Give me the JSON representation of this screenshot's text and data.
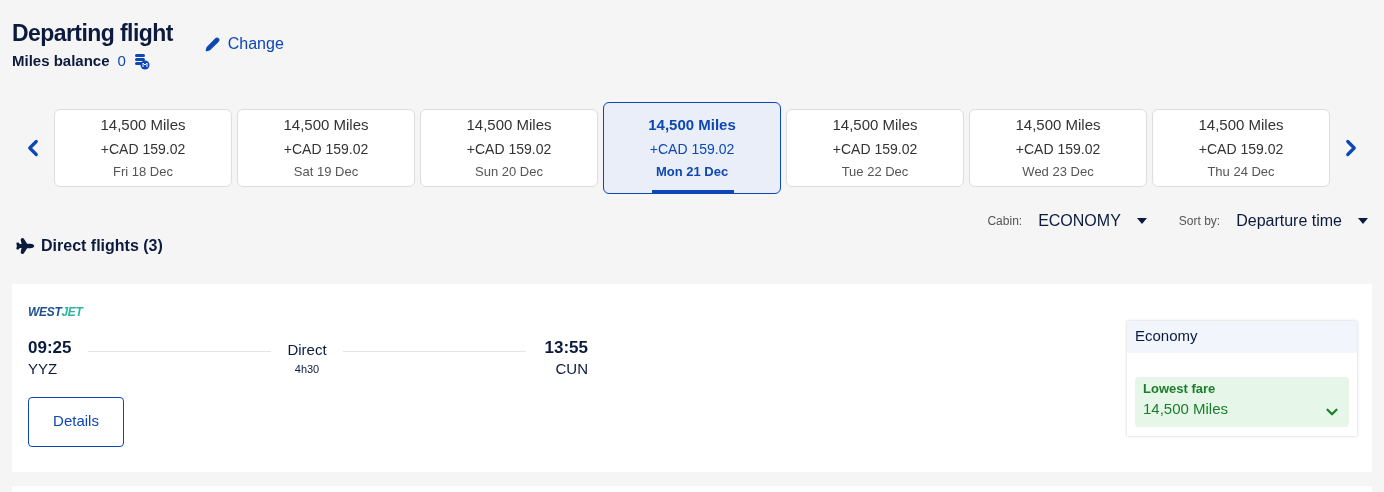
{
  "header": {
    "title": "Departing flight",
    "change_link": "Change",
    "balance_label": "Miles balance",
    "balance_value": "0"
  },
  "dates": [
    {
      "miles": "14,500 Miles",
      "price": "+CAD 159.02",
      "date": "Fri 18 Dec",
      "selected": false
    },
    {
      "miles": "14,500 Miles",
      "price": "+CAD 159.02",
      "date": "Sat 19 Dec",
      "selected": false
    },
    {
      "miles": "14,500 Miles",
      "price": "+CAD 159.02",
      "date": "Sun 20 Dec",
      "selected": false
    },
    {
      "miles": "14,500 Miles",
      "price": "+CAD 159.02",
      "date": "Mon 21 Dec",
      "selected": true
    },
    {
      "miles": "14,500 Miles",
      "price": "+CAD 159.02",
      "date": "Tue 22 Dec",
      "selected": false
    },
    {
      "miles": "14,500 Miles",
      "price": "+CAD 159.02",
      "date": "Wed 23 Dec",
      "selected": false
    },
    {
      "miles": "14,500 Miles",
      "price": "+CAD 159.02",
      "date": "Thu 24 Dec",
      "selected": false
    }
  ],
  "filters": [
    {
      "label": "Cabin:",
      "value": "ECONOMY"
    },
    {
      "label": "Sort by:",
      "value": "Departure time"
    }
  ],
  "section_title": "Direct flights (3)",
  "flight": {
    "logo": [
      "WEST",
      "JET"
    ],
    "depart_time": "09:25",
    "depart_airport": "YYZ",
    "stops": "Direct",
    "duration": "4h30",
    "arrive_time": "13:55",
    "arrive_airport": "CUN",
    "details_button": "Details",
    "fare": {
      "cabin": "Economy",
      "badge": "Lowest fare",
      "miles": "14,500 Miles"
    }
  }
}
